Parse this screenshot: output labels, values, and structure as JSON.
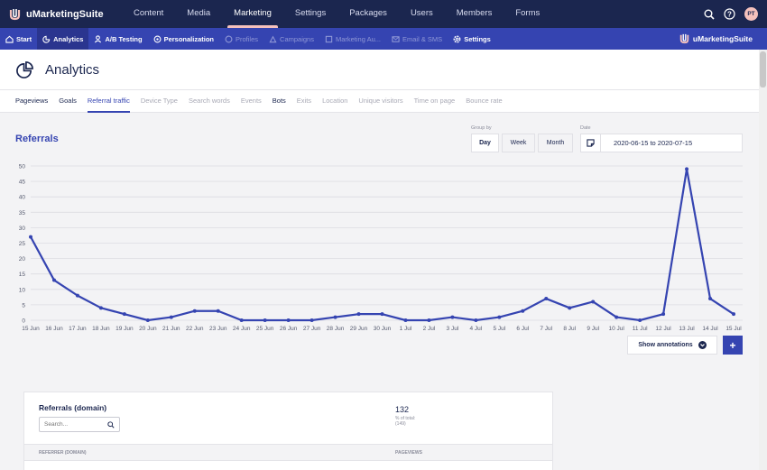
{
  "app": {
    "brand": "uMarketingSuite"
  },
  "topnav": [
    {
      "label": "Content",
      "active": false
    },
    {
      "label": "Media",
      "active": false
    },
    {
      "label": "Marketing",
      "active": true
    },
    {
      "label": "Settings",
      "active": false
    },
    {
      "label": "Packages",
      "active": false
    },
    {
      "label": "Users",
      "active": false
    },
    {
      "label": "Members",
      "active": false
    },
    {
      "label": "Forms",
      "active": false
    }
  ],
  "user": {
    "initials": "PT"
  },
  "subnav": [
    {
      "label": "Start",
      "icon": "home-icon",
      "state": "enabled"
    },
    {
      "label": "Analytics",
      "icon": "analytics-icon",
      "state": "active"
    },
    {
      "label": "A/B Testing",
      "icon": "user-icon",
      "state": "enabled"
    },
    {
      "label": "Personalization",
      "icon": "personalization-icon",
      "state": "enabled"
    },
    {
      "label": "Profiles",
      "icon": "profiles-icon",
      "state": "disabled"
    },
    {
      "label": "Campaigns",
      "icon": "campaigns-icon",
      "state": "disabled"
    },
    {
      "label": "Marketing Au...",
      "icon": "automation-icon",
      "state": "disabled"
    },
    {
      "label": "Email & SMS",
      "icon": "email-icon",
      "state": "disabled"
    },
    {
      "label": "Settings",
      "icon": "gear-icon",
      "state": "enabled"
    }
  ],
  "page": {
    "title": "Analytics"
  },
  "tabs": [
    {
      "label": "Pageviews",
      "state": "enabled"
    },
    {
      "label": "Goals",
      "state": "enabled"
    },
    {
      "label": "Referral traffic",
      "state": "active"
    },
    {
      "label": "Device Type",
      "state": "disabled"
    },
    {
      "label": "Search words",
      "state": "disabled"
    },
    {
      "label": "Events",
      "state": "disabled"
    },
    {
      "label": "Bots",
      "state": "enabled"
    },
    {
      "label": "Exits",
      "state": "disabled"
    },
    {
      "label": "Location",
      "state": "disabled"
    },
    {
      "label": "Unique visitors",
      "state": "disabled"
    },
    {
      "label": "Time on page",
      "state": "disabled"
    },
    {
      "label": "Bounce rate",
      "state": "disabled"
    }
  ],
  "referrals": {
    "title": "Referrals",
    "group_by_label": "Group by",
    "group_by_options": [
      {
        "label": "Day",
        "active": true
      },
      {
        "label": "Week",
        "active": false
      },
      {
        "label": "Month",
        "active": false
      }
    ],
    "date_label": "Date",
    "date_range": "2020-06-15 to 2020-07-15",
    "show_annotations": "Show annotations",
    "add_label": "+"
  },
  "chart_data": {
    "type": "line",
    "x": [
      "15 Jun",
      "16 Jun",
      "17 Jun",
      "18 Jun",
      "19 Jun",
      "20 Jun",
      "21 Jun",
      "22 Jun",
      "23 Jun",
      "24 Jun",
      "25 Jun",
      "26 Jun",
      "27 Jun",
      "28 Jun",
      "29 Jun",
      "30 Jun",
      "1 Jul",
      "2 Jul",
      "3 Jul",
      "4 Jul",
      "5 Jul",
      "6 Jul",
      "7 Jul",
      "8 Jul",
      "9 Jul",
      "10 Jul",
      "11 Jul",
      "12 Jul",
      "13 Jul",
      "14 Jul",
      "15 Jul"
    ],
    "values": [
      27,
      13,
      8,
      4,
      2,
      0,
      1,
      3,
      3,
      0,
      0,
      0,
      0,
      1,
      2,
      2,
      0,
      0,
      1,
      0,
      1,
      3,
      7,
      4,
      6,
      1,
      0,
      2,
      49,
      7,
      2
    ],
    "yticks": [
      0,
      5,
      10,
      15,
      20,
      25,
      30,
      35,
      40,
      45,
      50
    ],
    "ylim": [
      0,
      50
    ],
    "grid": true,
    "color": "#3544b1"
  },
  "domain_card": {
    "title": "Referrals (domain)",
    "search_placeholder": "Search...",
    "total": "132",
    "total_pct_label": "% of total:",
    "total_pct_value": "(149)",
    "columns": [
      "REFERRER (DOMAIN)",
      "PAGEVIEWS"
    ]
  }
}
